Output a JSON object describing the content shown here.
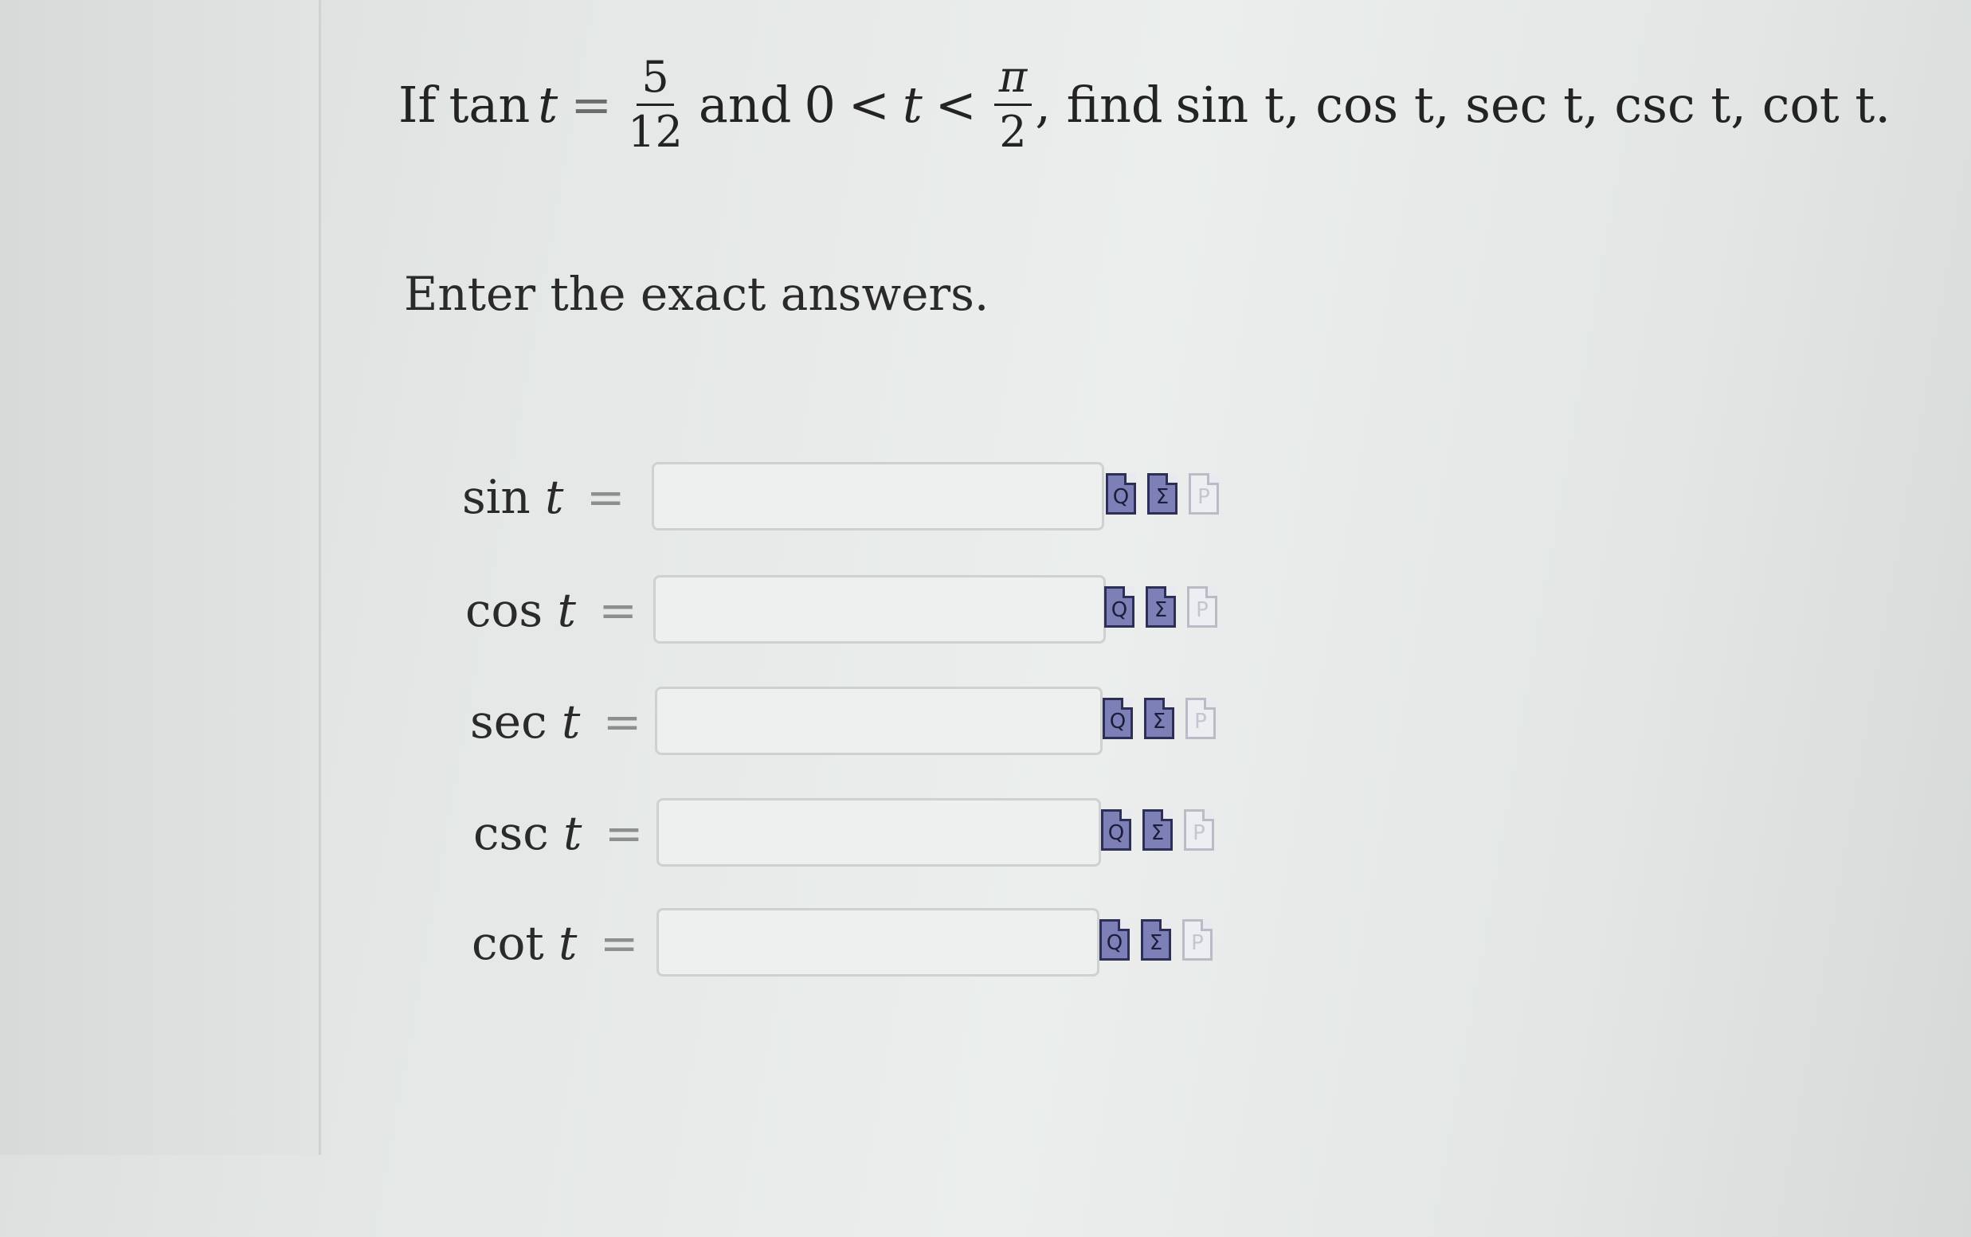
{
  "question": {
    "prefix": "If",
    "tan_fn": "tan",
    "var": "t",
    "equals": "=",
    "frac_num": "5",
    "frac_den": "12",
    "and_text": "and",
    "zero": "0",
    "lt1": "<",
    "lt2": "<",
    "pi_num": "π",
    "pi_den": "2",
    "find_text": ", find",
    "targets": "sin t, cos t, sec t, csc t, cot t."
  },
  "instructions": "Enter the exact answers.",
  "answers": [
    {
      "fn": "sin",
      "var": "t",
      "eq": "=",
      "value": ""
    },
    {
      "fn": "cos",
      "var": "t",
      "eq": "=",
      "value": ""
    },
    {
      "fn": "sec",
      "var": "t",
      "eq": "=",
      "value": ""
    },
    {
      "fn": "csc",
      "var": "t",
      "eq": "=",
      "value": ""
    },
    {
      "fn": "cot",
      "var": "t",
      "eq": "=",
      "value": ""
    }
  ],
  "icons": {
    "preview": {
      "name": "preview-icon",
      "glyph": "Q"
    },
    "equation_editor": {
      "name": "equation-editor-icon",
      "glyph": "Σ"
    },
    "help": {
      "name": "help-icon",
      "glyph": "P",
      "state": "disabled"
    }
  },
  "colors": {
    "icon_fill": "#7d80b6",
    "icon_border": "#2d2f55",
    "input_border": "#cfd1d0"
  }
}
